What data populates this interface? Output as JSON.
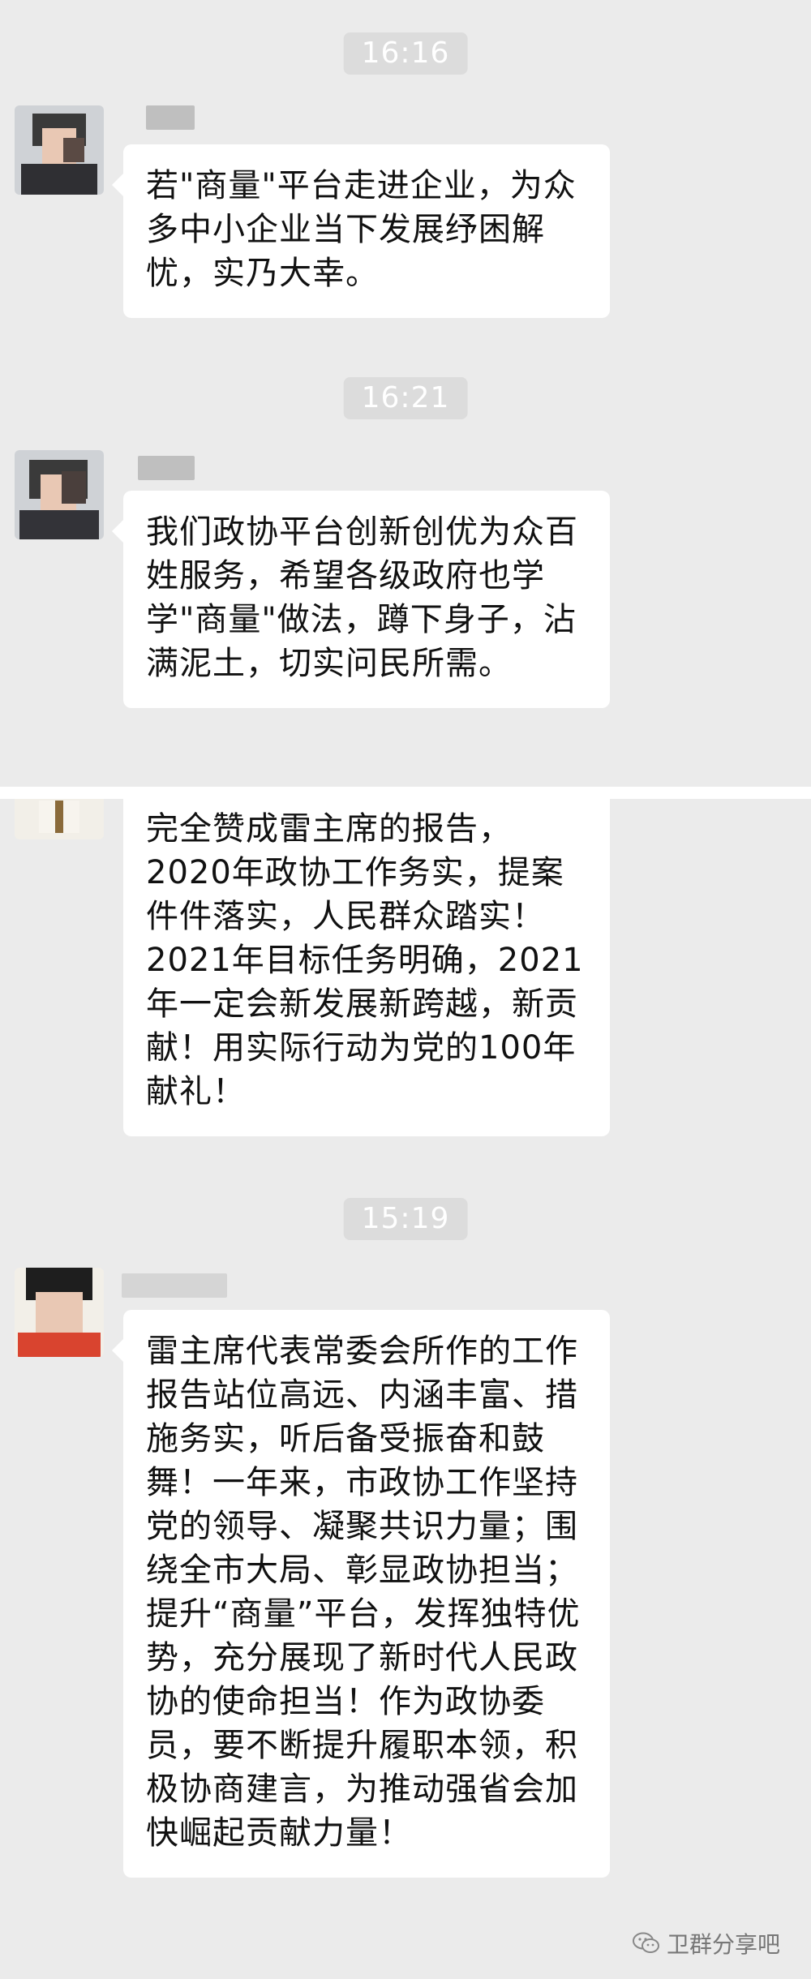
{
  "panel1": {
    "messages": [
      {
        "time": "16:16",
        "sender": "",
        "text": "若\"商量\"平台走进企业，为众多中小企业当下发展纾困解忧，实乃大幸。"
      },
      {
        "time": "16:21",
        "sender": "",
        "text": "我们政协平台创新创优为众百姓服务，希望各级政府也学学\"商量\"做法，蹲下身子，沾满泥土，切实问民所需。"
      }
    ]
  },
  "panel2": {
    "messages": [
      {
        "time": "",
        "sender": "",
        "text": "完全赞成雷主席的报告，2020年政协工作务实，提案件件落实，人民群众踏实！2021年目标任务明确，2021年一定会新发展新跨越，新贡献！用实际行动为党的100年献礼！"
      },
      {
        "time": "15:19",
        "sender": "",
        "text": "雷主席代表常委会所作的工作报告站位高远、内涵丰富、措施务实，听后备受振奋和鼓舞！一年来，市政协工作坚持党的领导、凝聚共识力量；围绕全市大局、彰显政协担当；提升“商量”平台，发挥独特优势，充分展现了新时代人民政协的使命担当！作为政协委员，要不断提升履职本领，积极协商建言，为推动强省会加快崛起贡献力量！"
      }
    ]
  },
  "watermark": {
    "text": "卫群分享吧",
    "icon": "wechat-icon"
  },
  "colors": {
    "background": "#ebebeb",
    "bubble": "#ffffff",
    "timestamp_bg": "#dcdcdc",
    "timestamp_text": "#ffffff"
  }
}
